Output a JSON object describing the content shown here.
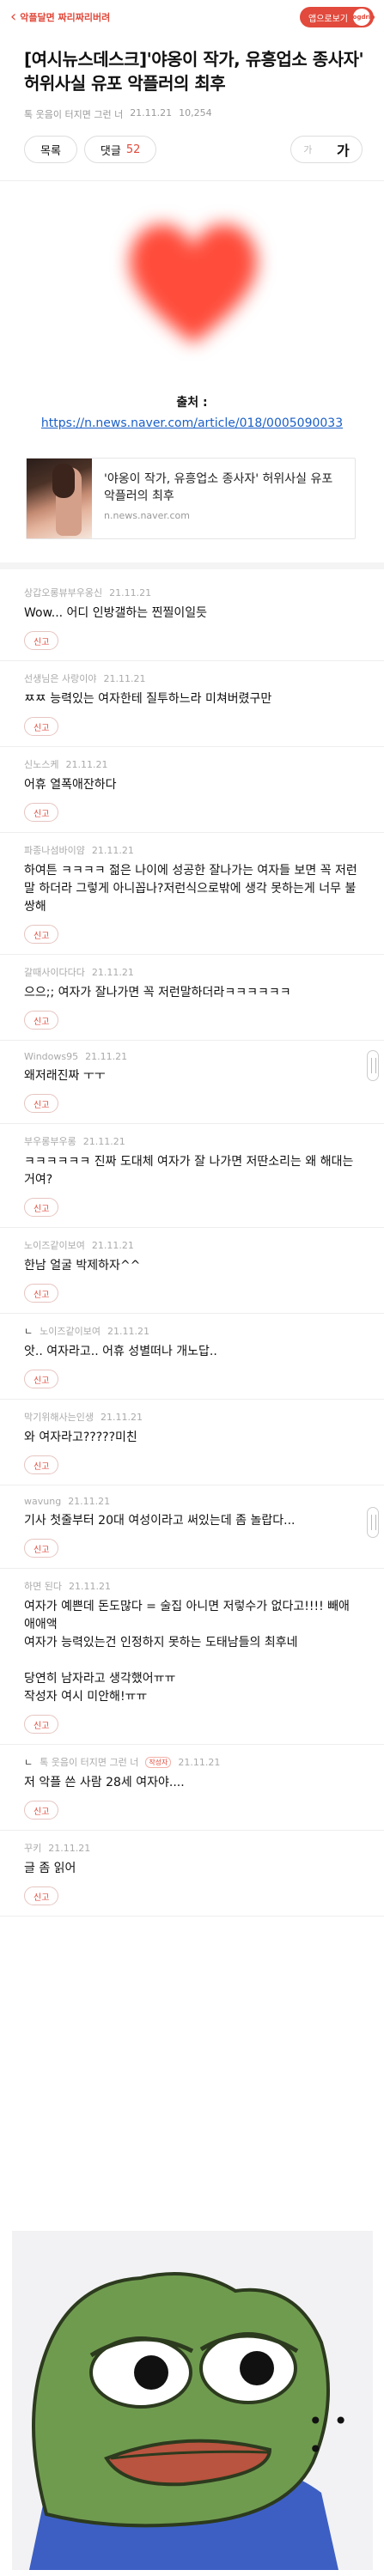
{
  "topbar": {
    "back_label": "악플달면 짜리짜리버려",
    "app_button_label": "앱으로보기",
    "app_logo_text": "dogdrip"
  },
  "post": {
    "title": "[여시뉴스데스크]'야옹이 작가, 유흥업소 종사자' 허위사실 유포 악플러의 최후",
    "author": "톡 웃음이 터지면 그런 너",
    "date": "21.11.21",
    "views": "10,254",
    "list_button": "목록",
    "comment_button": "댓글",
    "comment_count": "52",
    "font_small": "가",
    "font_big": "가",
    "source_label": "출처 :",
    "source_url": "https://n.news.naver.com/article/018/0005090033",
    "card_title": "'야옹이 작가, 유흥업소 종사자' 허위사실 유포 악플러의 최후",
    "card_domain": "n.news.naver.com"
  },
  "comments": [
    {
      "author": "상갑오롱뷰부우옹신",
      "date": "21.11.21",
      "text": "Wow... 어디 인방갤하는 찐찔이일듯",
      "report": "신고",
      "reply": false
    },
    {
      "author": "선생님은 사랑이야",
      "date": "21.11.21",
      "text": "ㅉㅉ 능력있는 여자한테 질투하느라 미쳐버렸구만",
      "report": "신고",
      "reply": false
    },
    {
      "author": "신노스케",
      "date": "21.11.21",
      "text": "어휴 열폭애잔하다",
      "report": "신고",
      "reply": false
    },
    {
      "author": "파종나섬바이얌",
      "date": "21.11.21",
      "text": "하여튼 ㅋㅋㅋㅋ 젊은 나이에 성공한 잘나가는 여자들 보면 꼭 저런말 하더라 그렇게 아니꼽나?저런식으로밖에 생각 못하는게 너무 불쌍해",
      "report": "신고",
      "reply": false
    },
    {
      "author": "갈때사이다다다",
      "date": "21.11.21",
      "text": "으으;; 여자가 잘나가면 꼭 저런말하더라ㅋㅋㅋㅋㅋㅋ",
      "report": "신고",
      "reply": false
    },
    {
      "author": "Windows95",
      "date": "21.11.21",
      "text": "왜저래진짜 ㅜㅜ",
      "report": "신고",
      "reply": false
    },
    {
      "author": "부우롱부우롱",
      "date": "21.11.21",
      "text": "ㅋㅋㅋㅋㅋㅋ 진짜 도대체 여자가 잘 나가면 저딴소리는 왜 해대는거여?",
      "report": "신고",
      "reply": false
    },
    {
      "author": "노이즈같이보여",
      "date": "21.11.21",
      "text": "한남 얼굴 박제하자^^",
      "report": "신고",
      "reply": false
    },
    {
      "author": "노이즈같이보여",
      "date": "21.11.21",
      "text": "앗.. 여자라고.. 어휴 성별떠나 개노답..",
      "report": "신고",
      "reply": true
    },
    {
      "author": "막기위해사는인생",
      "date": "21.11.21",
      "text": "와 여자라고?????미친",
      "report": "신고",
      "reply": false
    },
    {
      "author": "wavung",
      "date": "21.11.21",
      "text": "기사 첫줄부터 20대 여성이라고 써있는데 좀 놀랍다...",
      "report": "신고",
      "reply": false
    },
    {
      "author": "하면 된다",
      "date": "21.11.21",
      "text": "여자가 예쁜데 돈도많다 = 술집 아니면 저렇수가 없다고!!!! 빼애애애액\n여자가 능력있는건 인정하지 못하는 도태남들의 최후네\n\n당연히 남자라고 생각했어ㅠㅠ\n작성자 여시 미안해!ㅠㅠ",
      "report": "신고",
      "reply": false
    },
    {
      "author": "톡 웃음이 터지면 그런 너",
      "tag": "작성자",
      "date": "21.11.21",
      "text": "저 악플 쓴 사람 28세 여자야....",
      "report": "신고",
      "reply": true
    },
    {
      "author": "꾸키",
      "date": "21.11.21",
      "text": "글 좀 읽어",
      "report": "신고",
      "reply": false
    }
  ],
  "bottom_image": {
    "dots": "• • •",
    "colors": {
      "skin": "#6f9b4f",
      "shirt": "#3d5fc4",
      "lips": "#b8543f"
    }
  },
  "colors": {
    "accent": "#e14a3c",
    "link": "#1a5fc7",
    "heart": "#ff4c3b"
  }
}
